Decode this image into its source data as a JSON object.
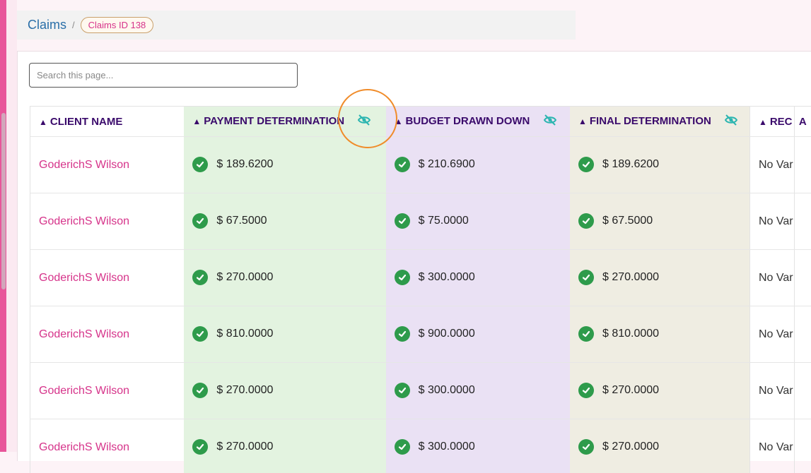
{
  "breadcrumb": {
    "parent": "Claims",
    "separator": "/",
    "badge": "Claims ID 138"
  },
  "search": {
    "placeholder": "Search this page..."
  },
  "table": {
    "headers": {
      "client_name": "CLIENT NAME",
      "payment_determination": "PAYMENT DETERMINATION",
      "budget_drawn_down": "BUDGET DRAWN DOWN",
      "final_determination": "FINAL DETERMINATION",
      "rec": "REC",
      "next": "A"
    },
    "sort_glyph": "▲",
    "rows": [
      {
        "client": "GoderichS Wilson",
        "payment": "$ 189.6200",
        "budget": "$ 210.6900",
        "final": "$ 189.6200",
        "rec": "No Var"
      },
      {
        "client": "GoderichS Wilson",
        "payment": "$ 67.5000",
        "budget": "$ 75.0000",
        "final": "$ 67.5000",
        "rec": "No Var"
      },
      {
        "client": "GoderichS Wilson",
        "payment": "$ 270.0000",
        "budget": "$ 300.0000",
        "final": "$ 270.0000",
        "rec": "No Var"
      },
      {
        "client": "GoderichS Wilson",
        "payment": "$ 810.0000",
        "budget": "$ 900.0000",
        "final": "$ 810.0000",
        "rec": "No Var"
      },
      {
        "client": "GoderichS Wilson",
        "payment": "$ 270.0000",
        "budget": "$ 300.0000",
        "final": "$ 270.0000",
        "rec": "No Var"
      },
      {
        "client": "GoderichS Wilson",
        "payment": "$ 270.0000",
        "budget": "$ 300.0000",
        "final": "$ 270.0000",
        "rec": "No Var"
      }
    ]
  },
  "icons": {
    "hide_column": "eye-off-icon",
    "status": "check-circle-icon"
  },
  "colors": {
    "accent_pink": "#d6338a",
    "header_text": "#3a0a6b",
    "payment_col_bg": "#e3f3e0",
    "budget_col_bg": "#eae1f4",
    "final_col_bg": "#efede2",
    "check_green": "#2e9b4b",
    "hide_icon": "#2bb5b0",
    "highlight": "#f08c2a"
  }
}
